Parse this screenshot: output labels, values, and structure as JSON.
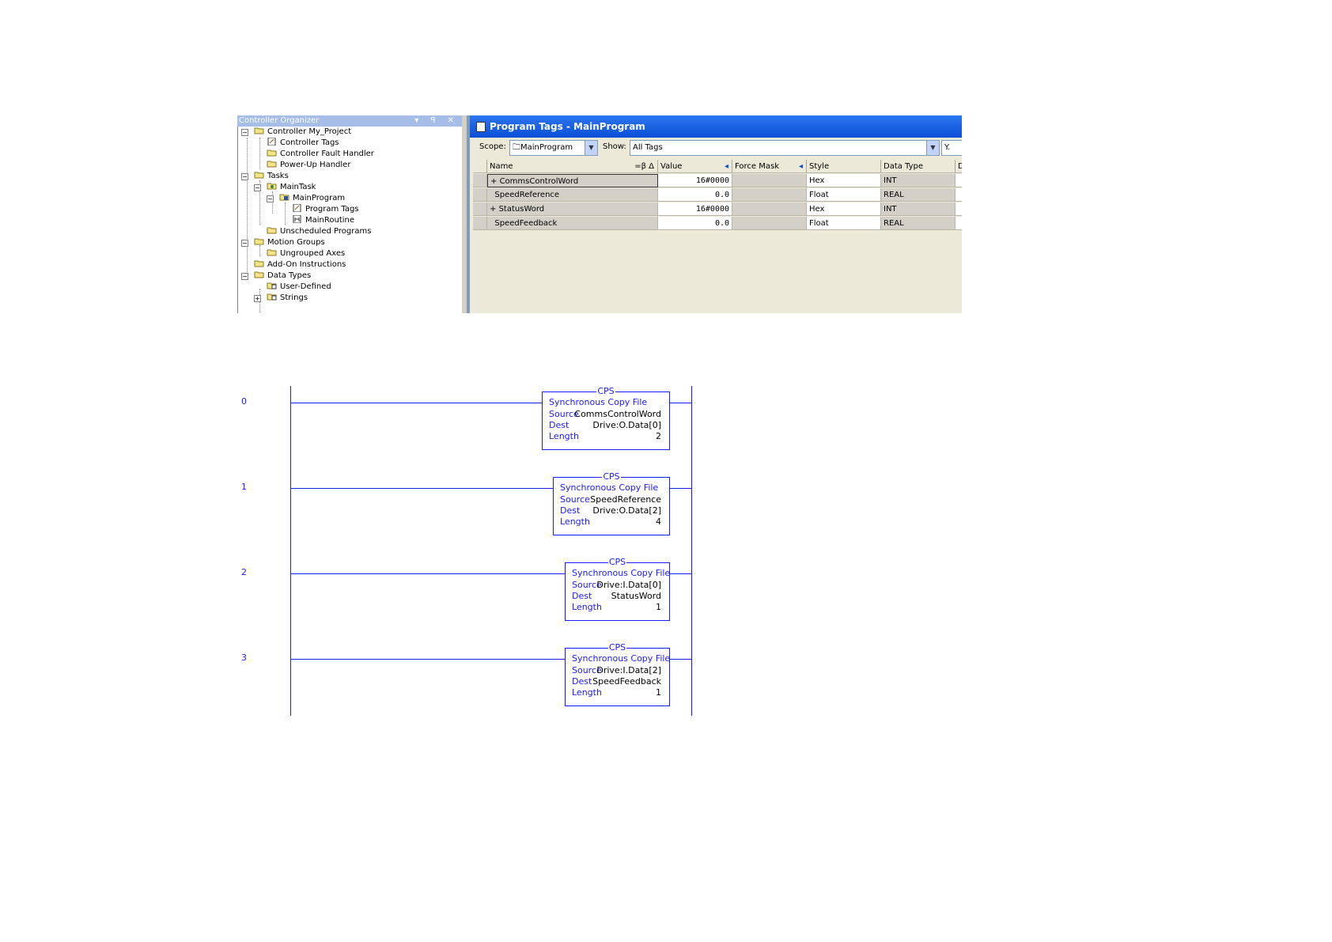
{
  "organizer": {
    "title": "Controller Organizer",
    "buttons": "▾ ꟼ ✕",
    "tree": [
      {
        "label": "Controller My_Project",
        "icon": "folder-open-icon"
      },
      {
        "label": "Controller Tags",
        "icon": "tags-icon"
      },
      {
        "label": "Controller Fault Handler",
        "icon": "folder-icon"
      },
      {
        "label": "Power-Up Handler",
        "icon": "folder-icon"
      },
      {
        "label": "Tasks",
        "icon": "folder-open-icon"
      },
      {
        "label": "MainTask",
        "icon": "task-icon"
      },
      {
        "label": "MainProgram",
        "icon": "program-icon"
      },
      {
        "label": "Program Tags",
        "icon": "tags-icon"
      },
      {
        "label": "MainRoutine",
        "icon": "routine-icon"
      },
      {
        "label": "Unscheduled Programs",
        "icon": "folder-icon"
      },
      {
        "label": "Motion Groups",
        "icon": "folder-open-icon"
      },
      {
        "label": "Ungrouped Axes",
        "icon": "folder-icon"
      },
      {
        "label": "Add-On Instructions",
        "icon": "folder-icon"
      },
      {
        "label": "Data Types",
        "icon": "folder-open-icon"
      },
      {
        "label": "User-Defined",
        "icon": "datatype-icon"
      },
      {
        "label": "Strings",
        "icon": "datatype-icon"
      }
    ]
  },
  "tags_window": {
    "title": "Program Tags - MainProgram",
    "scope_label": "Scope:",
    "scope_value": "MainProgram",
    "show_label": "Show:",
    "show_value": "All Tags",
    "filter_label": "Y.",
    "columns": {
      "name": "Name",
      "name_sort": "=β Δ",
      "value": "Value",
      "force_mask": "Force Mask",
      "style": "Style",
      "data_type": "Data Type",
      "d": "D"
    },
    "rows": [
      {
        "expand": "+",
        "name": "CommsControlWord",
        "value": "16#0000",
        "force": "",
        "style": "Hex",
        "dtype": "INT"
      },
      {
        "expand": "",
        "name": "SpeedReference",
        "value": "0.0",
        "force": "",
        "style": "Float",
        "dtype": "REAL"
      },
      {
        "expand": "+",
        "name": "StatusWord",
        "value": "16#0000",
        "force": "",
        "style": "Hex",
        "dtype": "INT"
      },
      {
        "expand": "",
        "name": "SpeedFeedback",
        "value": "0.0",
        "force": "",
        "style": "Float",
        "dtype": "REAL"
      }
    ]
  },
  "ladder": {
    "rungs": [
      {
        "number": "0",
        "instr": "CPS",
        "title": "Synchronous Copy File",
        "source_label": "Source",
        "source": "CommsControlWord",
        "dest_label": "Dest",
        "dest": "Drive:O.Data[0]",
        "length_label": "Length",
        "length": "2"
      },
      {
        "number": "1",
        "instr": "CPS",
        "title": "Synchronous Copy File",
        "source_label": "Source",
        "source": "SpeedReference",
        "dest_label": "Dest",
        "dest": "Drive:O.Data[2]",
        "length_label": "Length",
        "length": "4"
      },
      {
        "number": "2",
        "instr": "CPS",
        "title": "Synchronous Copy File",
        "source_label": "Source",
        "source": "Drive:I.Data[0]",
        "dest_label": "Dest",
        "dest": "StatusWord",
        "length_label": "Length",
        "length": "1"
      },
      {
        "number": "3",
        "instr": "CPS",
        "title": "Synchronous Copy File",
        "source_label": "Source",
        "source": "Drive:I.Data[2]",
        "dest_label": "Dest",
        "dest": "SpeedFeedback",
        "length_label": "Length",
        "length": "1"
      }
    ]
  },
  "colors": {
    "ladder": "#1a1aff",
    "title_bar": "#0a4fd6"
  }
}
